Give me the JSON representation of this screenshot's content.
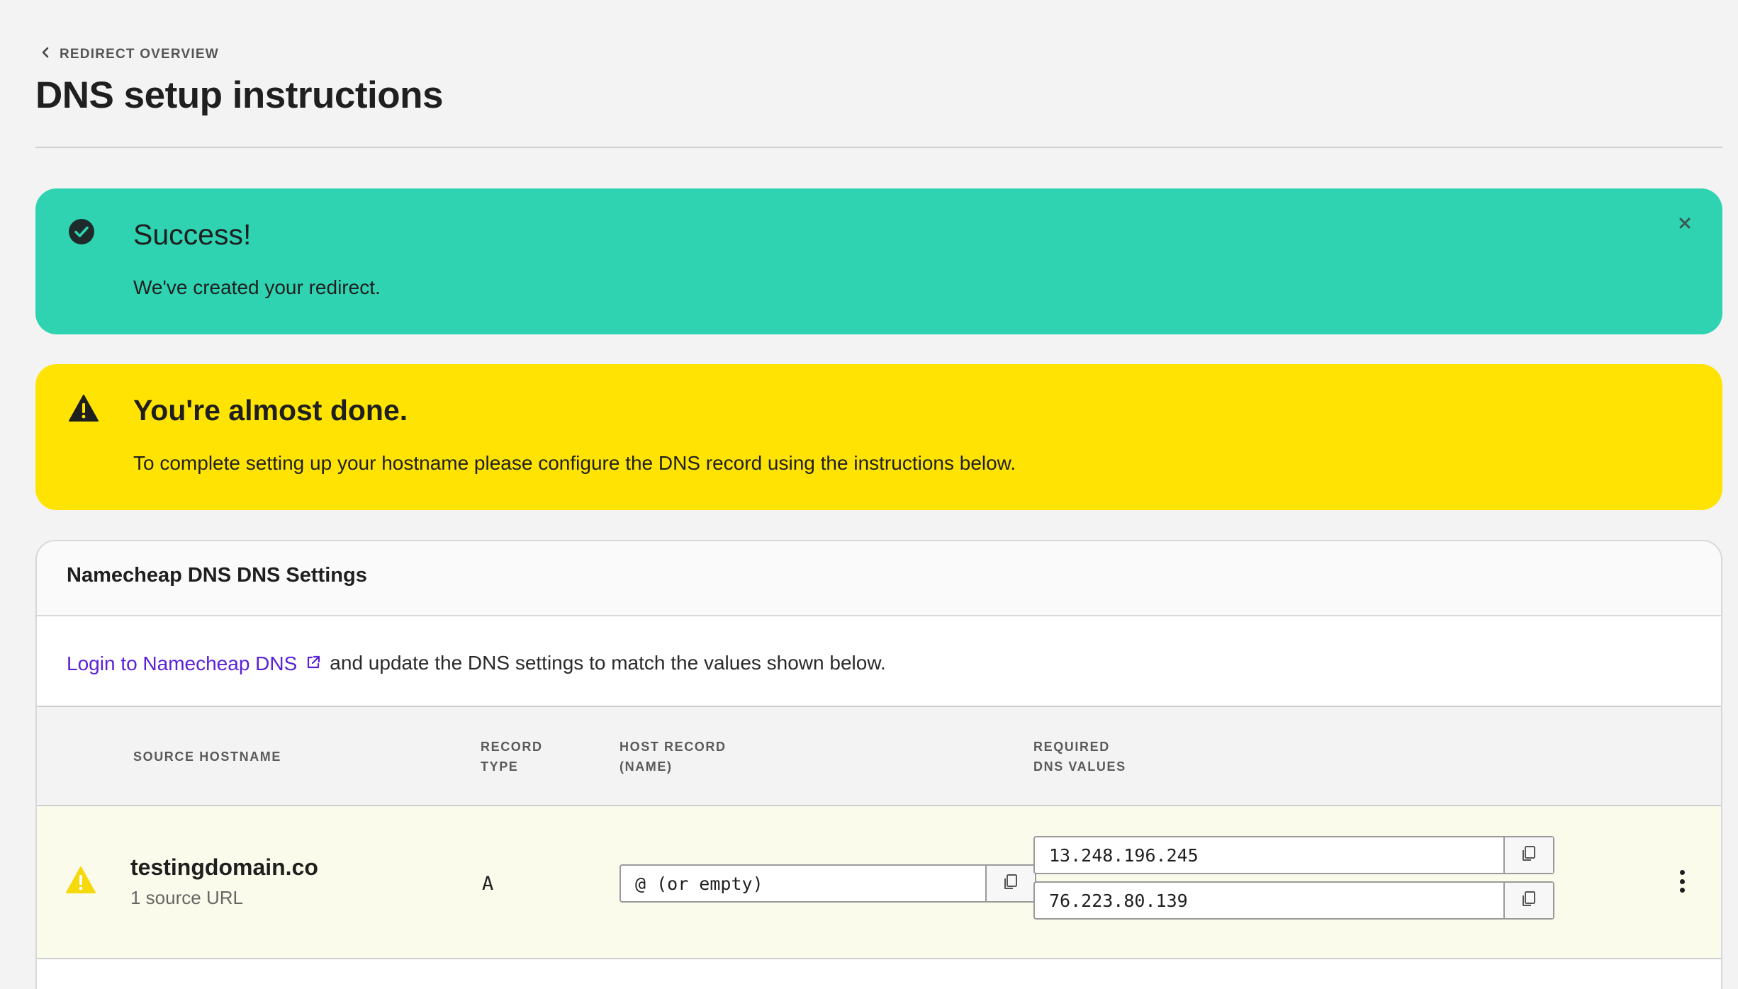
{
  "header": {
    "back_label": "REDIRECT OVERVIEW",
    "title": "DNS setup instructions"
  },
  "success_banner": {
    "icon": "check-circle-icon",
    "title": "Success!",
    "message": "We've created your redirect.",
    "close_icon": "close-icon",
    "color": "#2fd3b2"
  },
  "warning_banner": {
    "icon": "warning-triangle-icon",
    "title": "You're almost done.",
    "message": "To complete setting up your hostname please configure the DNS record using the instructions below.",
    "color": "#ffe303"
  },
  "dns_card": {
    "title": "Namecheap DNS DNS Settings",
    "login_link": "Login to Namecheap DNS",
    "intro_rest": "and update the DNS settings to match the values shown below.",
    "link_color": "#5a21d6",
    "columns": {
      "source": "SOURCE HOSTNAME",
      "type_line1": "RECORD",
      "type_line2": "TYPE",
      "host_line1": "HOST RECORD",
      "host_line2": "(NAME)",
      "dns_line1": "REQUIRED",
      "dns_line2": "DNS VALUES"
    },
    "rows": [
      {
        "hostname": "testingdomain.co",
        "subtitle": "1 source URL",
        "record_type": "A",
        "host_record": "@ (or empty)",
        "dns_values": [
          "13.248.196.245",
          "76.223.80.139"
        ],
        "status_icon": "warning-triangle-icon"
      }
    ]
  }
}
